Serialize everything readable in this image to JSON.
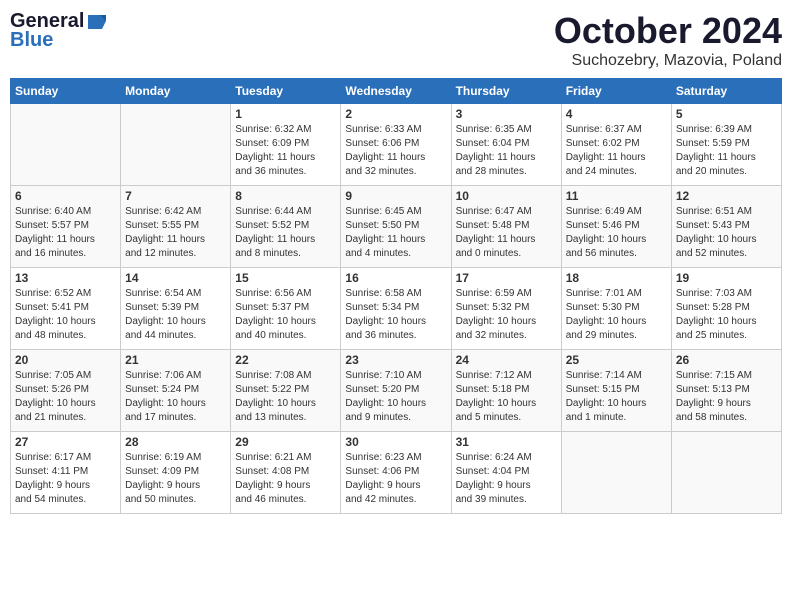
{
  "header": {
    "logo_line1": "General",
    "logo_line2": "Blue",
    "month": "October 2024",
    "location": "Suchozebry, Mazovia, Poland"
  },
  "weekdays": [
    "Sunday",
    "Monday",
    "Tuesday",
    "Wednesday",
    "Thursday",
    "Friday",
    "Saturday"
  ],
  "weeks": [
    [
      {
        "day": "",
        "info": ""
      },
      {
        "day": "",
        "info": ""
      },
      {
        "day": "1",
        "info": "Sunrise: 6:32 AM\nSunset: 6:09 PM\nDaylight: 11 hours\nand 36 minutes."
      },
      {
        "day": "2",
        "info": "Sunrise: 6:33 AM\nSunset: 6:06 PM\nDaylight: 11 hours\nand 32 minutes."
      },
      {
        "day": "3",
        "info": "Sunrise: 6:35 AM\nSunset: 6:04 PM\nDaylight: 11 hours\nand 28 minutes."
      },
      {
        "day": "4",
        "info": "Sunrise: 6:37 AM\nSunset: 6:02 PM\nDaylight: 11 hours\nand 24 minutes."
      },
      {
        "day": "5",
        "info": "Sunrise: 6:39 AM\nSunset: 5:59 PM\nDaylight: 11 hours\nand 20 minutes."
      }
    ],
    [
      {
        "day": "6",
        "info": "Sunrise: 6:40 AM\nSunset: 5:57 PM\nDaylight: 11 hours\nand 16 minutes."
      },
      {
        "day": "7",
        "info": "Sunrise: 6:42 AM\nSunset: 5:55 PM\nDaylight: 11 hours\nand 12 minutes."
      },
      {
        "day": "8",
        "info": "Sunrise: 6:44 AM\nSunset: 5:52 PM\nDaylight: 11 hours\nand 8 minutes."
      },
      {
        "day": "9",
        "info": "Sunrise: 6:45 AM\nSunset: 5:50 PM\nDaylight: 11 hours\nand 4 minutes."
      },
      {
        "day": "10",
        "info": "Sunrise: 6:47 AM\nSunset: 5:48 PM\nDaylight: 11 hours\nand 0 minutes."
      },
      {
        "day": "11",
        "info": "Sunrise: 6:49 AM\nSunset: 5:46 PM\nDaylight: 10 hours\nand 56 minutes."
      },
      {
        "day": "12",
        "info": "Sunrise: 6:51 AM\nSunset: 5:43 PM\nDaylight: 10 hours\nand 52 minutes."
      }
    ],
    [
      {
        "day": "13",
        "info": "Sunrise: 6:52 AM\nSunset: 5:41 PM\nDaylight: 10 hours\nand 48 minutes."
      },
      {
        "day": "14",
        "info": "Sunrise: 6:54 AM\nSunset: 5:39 PM\nDaylight: 10 hours\nand 44 minutes."
      },
      {
        "day": "15",
        "info": "Sunrise: 6:56 AM\nSunset: 5:37 PM\nDaylight: 10 hours\nand 40 minutes."
      },
      {
        "day": "16",
        "info": "Sunrise: 6:58 AM\nSunset: 5:34 PM\nDaylight: 10 hours\nand 36 minutes."
      },
      {
        "day": "17",
        "info": "Sunrise: 6:59 AM\nSunset: 5:32 PM\nDaylight: 10 hours\nand 32 minutes."
      },
      {
        "day": "18",
        "info": "Sunrise: 7:01 AM\nSunset: 5:30 PM\nDaylight: 10 hours\nand 29 minutes."
      },
      {
        "day": "19",
        "info": "Sunrise: 7:03 AM\nSunset: 5:28 PM\nDaylight: 10 hours\nand 25 minutes."
      }
    ],
    [
      {
        "day": "20",
        "info": "Sunrise: 7:05 AM\nSunset: 5:26 PM\nDaylight: 10 hours\nand 21 minutes."
      },
      {
        "day": "21",
        "info": "Sunrise: 7:06 AM\nSunset: 5:24 PM\nDaylight: 10 hours\nand 17 minutes."
      },
      {
        "day": "22",
        "info": "Sunrise: 7:08 AM\nSunset: 5:22 PM\nDaylight: 10 hours\nand 13 minutes."
      },
      {
        "day": "23",
        "info": "Sunrise: 7:10 AM\nSunset: 5:20 PM\nDaylight: 10 hours\nand 9 minutes."
      },
      {
        "day": "24",
        "info": "Sunrise: 7:12 AM\nSunset: 5:18 PM\nDaylight: 10 hours\nand 5 minutes."
      },
      {
        "day": "25",
        "info": "Sunrise: 7:14 AM\nSunset: 5:15 PM\nDaylight: 10 hours\nand 1 minute."
      },
      {
        "day": "26",
        "info": "Sunrise: 7:15 AM\nSunset: 5:13 PM\nDaylight: 9 hours\nand 58 minutes."
      }
    ],
    [
      {
        "day": "27",
        "info": "Sunrise: 6:17 AM\nSunset: 4:11 PM\nDaylight: 9 hours\nand 54 minutes."
      },
      {
        "day": "28",
        "info": "Sunrise: 6:19 AM\nSunset: 4:09 PM\nDaylight: 9 hours\nand 50 minutes."
      },
      {
        "day": "29",
        "info": "Sunrise: 6:21 AM\nSunset: 4:08 PM\nDaylight: 9 hours\nand 46 minutes."
      },
      {
        "day": "30",
        "info": "Sunrise: 6:23 AM\nSunset: 4:06 PM\nDaylight: 9 hours\nand 42 minutes."
      },
      {
        "day": "31",
        "info": "Sunrise: 6:24 AM\nSunset: 4:04 PM\nDaylight: 9 hours\nand 39 minutes."
      },
      {
        "day": "",
        "info": ""
      },
      {
        "day": "",
        "info": ""
      }
    ]
  ]
}
